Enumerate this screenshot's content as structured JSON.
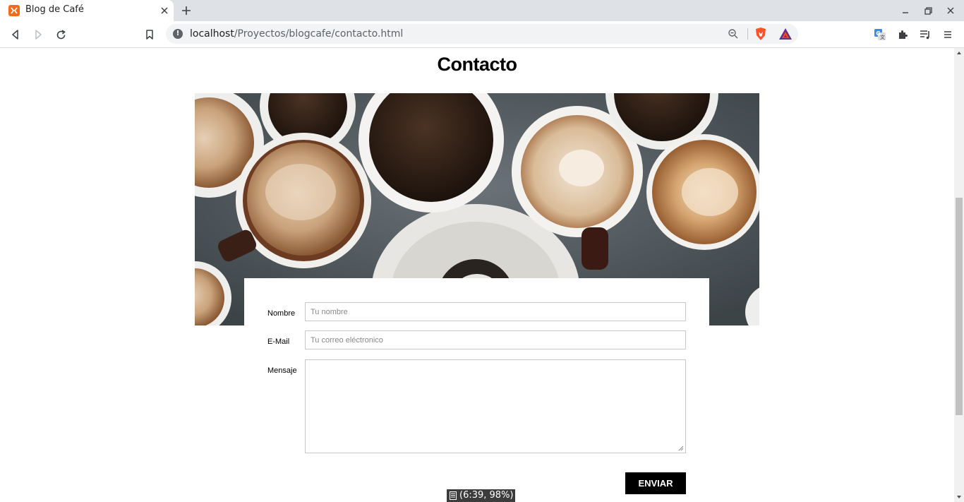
{
  "browser": {
    "tab": {
      "title": "Blog de Café",
      "favicon": "xampp-icon"
    },
    "url": {
      "host": "localhost",
      "path": "/Proyectos/blogcafe/contacto.html"
    },
    "icons": [
      "back-icon",
      "forward-icon",
      "reload-icon",
      "bookmark-icon",
      "zoom-icon",
      "brave-shields-icon",
      "brave-rewards-icon",
      "translate-icon",
      "extensions-icon",
      "reading-list-icon",
      "menu-icon",
      "minimize-icon",
      "restore-icon",
      "close-icon"
    ],
    "accent_color": "#f26a1b"
  },
  "page": {
    "title": "Contacto",
    "hero_image": "coffee-cups-image",
    "form": {
      "name_label": "Nombre",
      "name_placeholder": "Tu nombre",
      "email_label": "E-Mail",
      "email_placeholder": "Tu correo eléctronico",
      "message_label": "Mensaje",
      "submit_label": "ENVIAR"
    }
  },
  "status": {
    "text": "(6:39, 98%)"
  }
}
